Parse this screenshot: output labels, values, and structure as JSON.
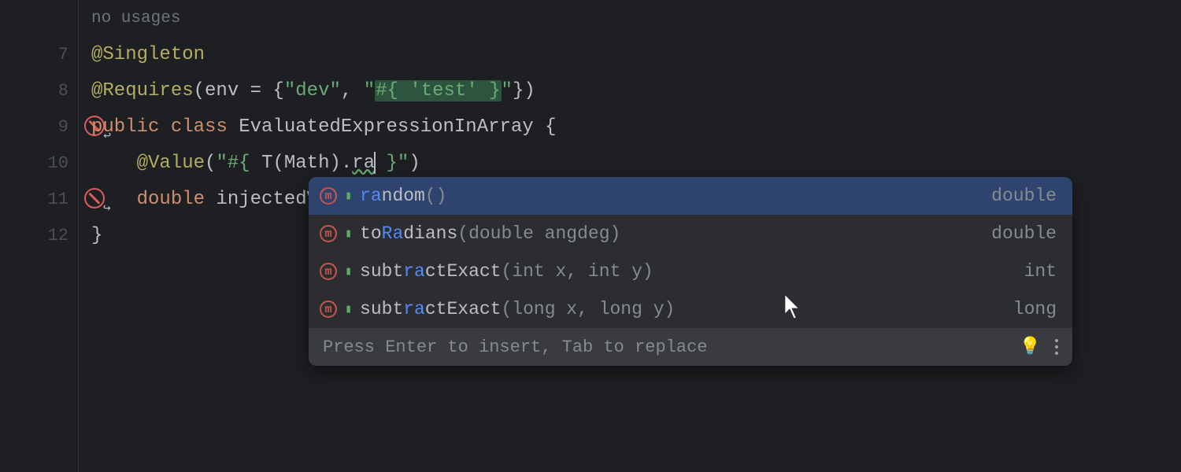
{
  "hint": {
    "noUsages": "no usages"
  },
  "lines": {
    "l7": {
      "num": "7",
      "annotation": "@Singleton"
    },
    "l8": {
      "num": "8",
      "at": "@",
      "name": "Requires",
      "lp": "(",
      "arg": "env = ",
      "brace1": "{",
      "q1": "\"dev\"",
      "comma": ", ",
      "q2a": "\"",
      "el_open": "#{ ",
      "el_body": "'test' ",
      "el_close": "}",
      "q2b": "\"",
      "brace2": "}",
      "rp": ")"
    },
    "l9": {
      "num": "9",
      "kw1": "public",
      "sp1": " ",
      "kw2": "class",
      "sp2": " ",
      "cls": "EvaluatedExpressionInArray",
      "sp3": " ",
      "br": "{"
    },
    "l10": {
      "num": "10",
      "indent": "    ",
      "at": "@",
      "name": "Value",
      "lp": "(",
      "qo": "\"",
      "el_open": "#{",
      "sp": " ",
      "t": "T",
      "tlp": "(",
      "math": "Math",
      "trp": ")",
      "dot": ".",
      "typed": "ra",
      "post": " }",
      "qc": "\"",
      "rp": ")"
    },
    "l11": {
      "num": "11",
      "indent": "    ",
      "kw": "double",
      "sp": " ",
      "id": "injectedValue;"
    },
    "l12": {
      "num": "12",
      "br": "}"
    }
  },
  "completion": {
    "items": [
      {
        "match": "ra",
        "rest": "ndom",
        "params": "()",
        "ret": "double"
      },
      {
        "pre": "to",
        "match": "Ra",
        "rest": "dians",
        "params": "(double angdeg)",
        "ret": "double"
      },
      {
        "pre": "subt",
        "match": "ra",
        "rest": "ctExact",
        "params": "(int x, int y)",
        "ret": "int"
      },
      {
        "pre": "subt",
        "match": "ra",
        "rest": "ctExact",
        "params": "(long x, long y)",
        "ret": "long"
      }
    ],
    "footer": "Press Enter to insert, Tab to replace"
  }
}
